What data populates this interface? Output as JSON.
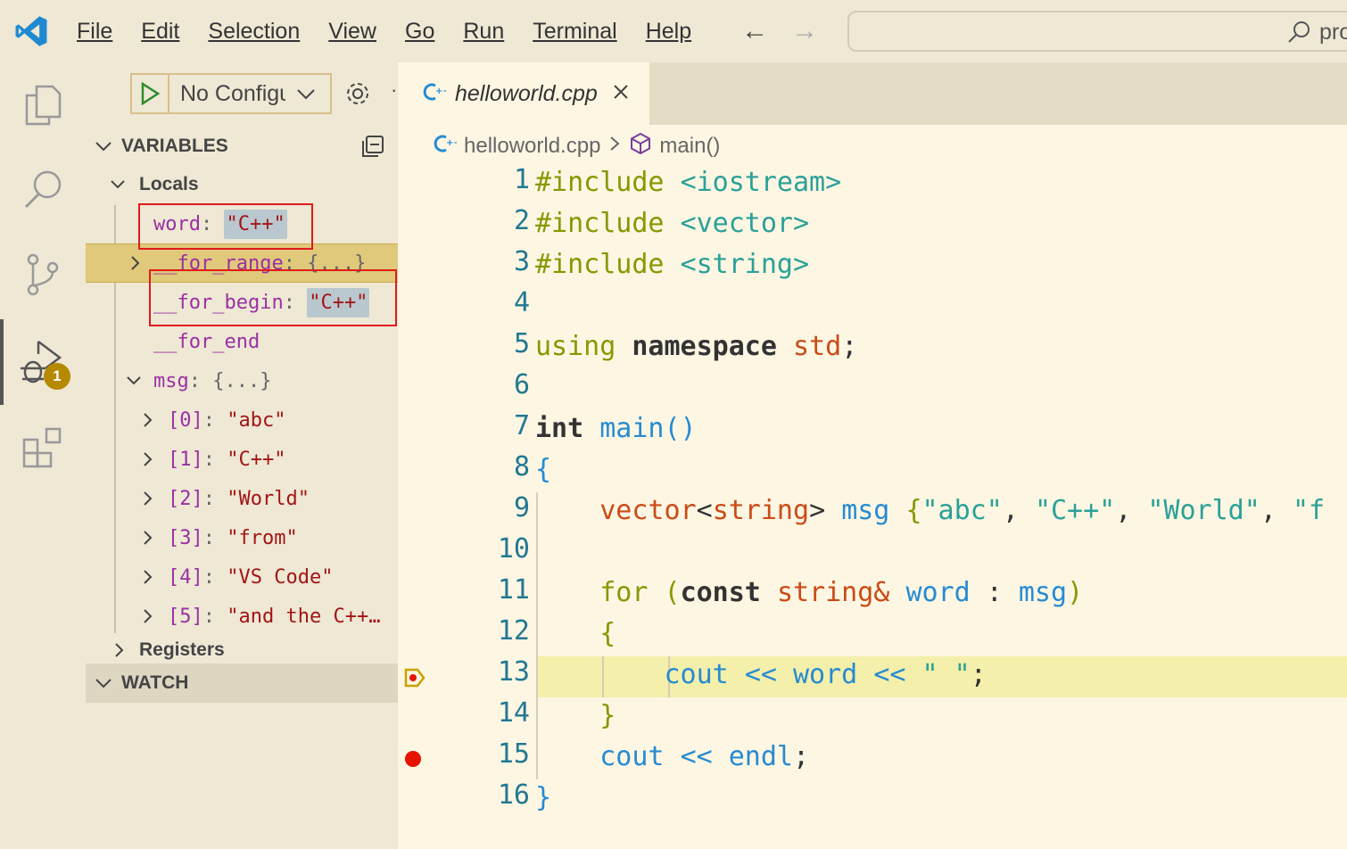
{
  "menu": {
    "file": "File",
    "edit": "Edit",
    "selection": "Selection",
    "view": "View",
    "go": "Go",
    "run": "Run",
    "terminal": "Terminal",
    "help": "Help"
  },
  "search": {
    "text": "pro"
  },
  "activity": {
    "debug_badge": "1"
  },
  "debug": {
    "config_label": "No Configurations"
  },
  "variables": {
    "header": "VARIABLES",
    "locals_label": "Locals",
    "rows": [
      {
        "name": "word",
        "value": "\"C++\""
      },
      {
        "name": "__for_range",
        "value": "{...}"
      },
      {
        "name": "__for_begin",
        "value": "\"C++\""
      },
      {
        "name": "__for_end",
        "value": ""
      },
      {
        "name": "msg",
        "value": "{...}"
      },
      {
        "name": "[0]",
        "value": "\"abc\""
      },
      {
        "name": "[1]",
        "value": "\"C++\""
      },
      {
        "name": "[2]",
        "value": "\"World\""
      },
      {
        "name": "[3]",
        "value": "\"from\""
      },
      {
        "name": "[4]",
        "value": "\"VS Code\""
      },
      {
        "name": "[5]",
        "value": "\"and the C++…"
      }
    ],
    "registers_label": "Registers"
  },
  "watch": {
    "header": "WATCH"
  },
  "editor": {
    "tab_label": "helloworld.cpp",
    "breadcrumb_file": "helloworld.cpp",
    "breadcrumb_symbol": "main()",
    "current_line": 13,
    "breakpoint_line": 15,
    "lines": [
      "1",
      "2",
      "3",
      "4",
      "5",
      "6",
      "7",
      "8",
      "9",
      "10",
      "11",
      "12",
      "13",
      "14",
      "15",
      "16"
    ],
    "code": {
      "l1_inc": "#include",
      "l1_hdr": "<iostream>",
      "l2_inc": "#include",
      "l2_hdr": "<vector>",
      "l3_inc": "#include",
      "l3_hdr": "<string>",
      "l5_using": "using",
      "l5_namespace": "namespace",
      "l5_std": "std",
      "l5_semi": ";",
      "l7_int": "int",
      "l7_main": "main",
      "l7_parens": "()",
      "l8_brace": "{",
      "l9_vector": "vector",
      "l9_lt": "<",
      "l9_string": "string",
      "l9_gt": ">",
      "l9_msg": "msg",
      "l9_open": "{",
      "l9_s1": "\"abc\"",
      "l9_s2": "\"C++\"",
      "l9_s3": "\"World\"",
      "l9_s4": "\"f",
      "l9_comma": ", ",
      "l11_for": "for",
      "l11_paren": "(",
      "l11_const": "const",
      "l11_string": "string&",
      "l11_word": "word",
      "l11_colon": ":",
      "l11_msg": "msg",
      "l11_close": ")",
      "l12_brace": "{",
      "l13_cout": "cout",
      "l13_op1": "<<",
      "l13_word": "word",
      "l13_op2": "<<",
      "l13_str": "\" \"",
      "l13_semi": ";",
      "l14_brace": "}",
      "l15_cout": "cout",
      "l15_op": "<<",
      "l15_endl": "endl",
      "l15_semi": ";",
      "l16_brace": "}"
    }
  },
  "colors": {
    "editor_bg": "#fdf6e3",
    "sidebar_bg": "#eee8d5",
    "current_line": "#f4efaa",
    "breakpoint": "#e51400",
    "badge": "#b58900",
    "annotation_box": "#e01b1b"
  }
}
